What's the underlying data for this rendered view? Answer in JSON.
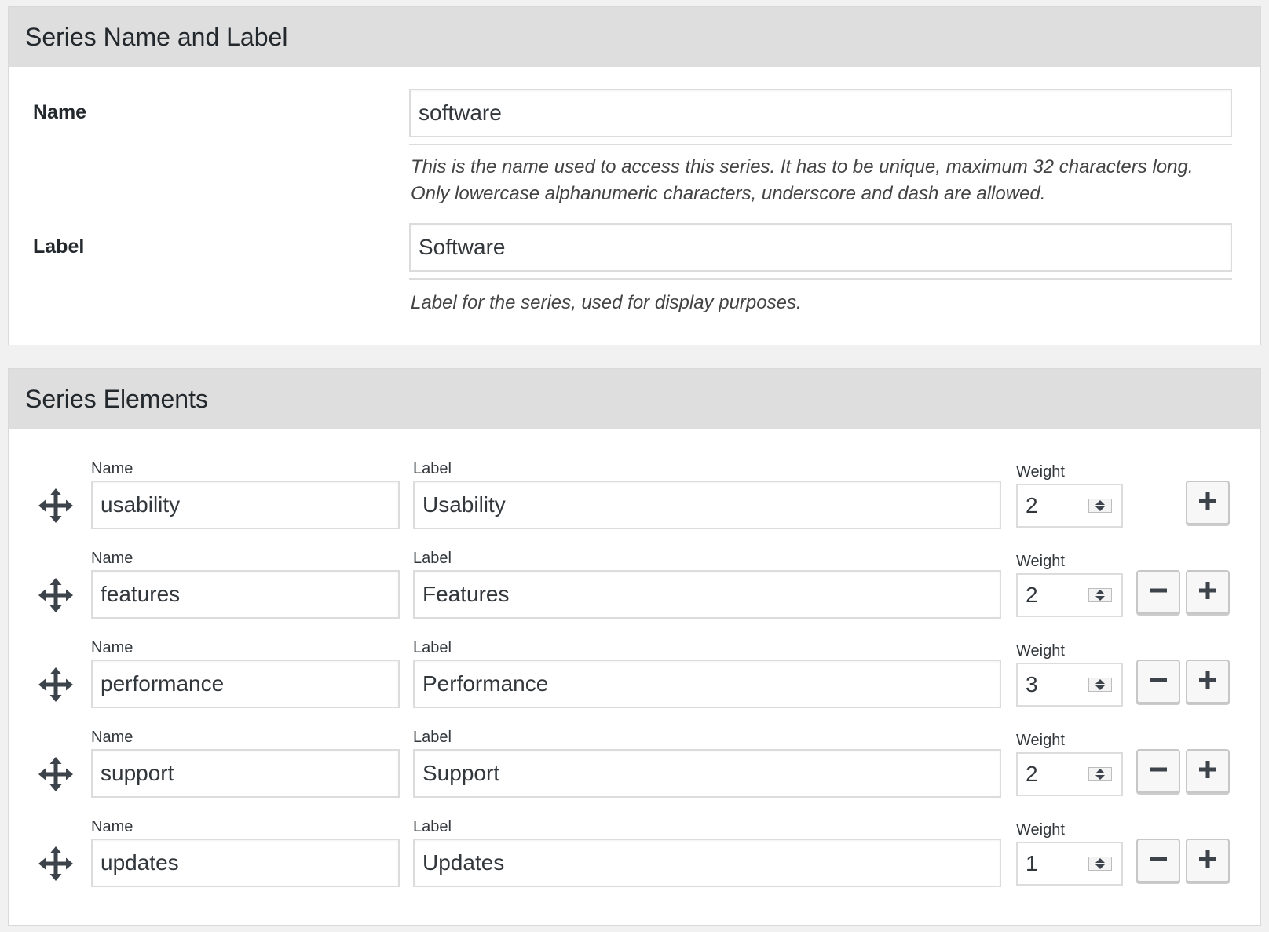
{
  "series_section": {
    "title": "Series Name and Label",
    "name_field": {
      "label": "Name",
      "value": "software",
      "description_line1": "This is the name used to access this series. It has to be unique, maximum 32 characters long.",
      "description_line2": "Only lowercase alphanumeric characters, underscore and dash are allowed."
    },
    "label_field": {
      "label": "Label",
      "value": "Software",
      "description": "Label for the series, used for display purposes."
    }
  },
  "elements_section": {
    "title": "Series Elements",
    "column_labels": {
      "name": "Name",
      "label": "Label",
      "weight": "Weight"
    },
    "rows": [
      {
        "name": "usability",
        "label": "Usability",
        "weight": "2",
        "removable": false
      },
      {
        "name": "features",
        "label": "Features",
        "weight": "2",
        "removable": true
      },
      {
        "name": "performance",
        "label": "Performance",
        "weight": "3",
        "removable": true
      },
      {
        "name": "support",
        "label": "Support",
        "weight": "2",
        "removable": true
      },
      {
        "name": "updates",
        "label": "Updates",
        "weight": "1",
        "removable": true
      }
    ],
    "icons": {
      "drag": "move-arrows-icon",
      "add": "plus-icon",
      "remove": "minus-icon",
      "spinner": "spinner-arrows-icon"
    }
  }
}
